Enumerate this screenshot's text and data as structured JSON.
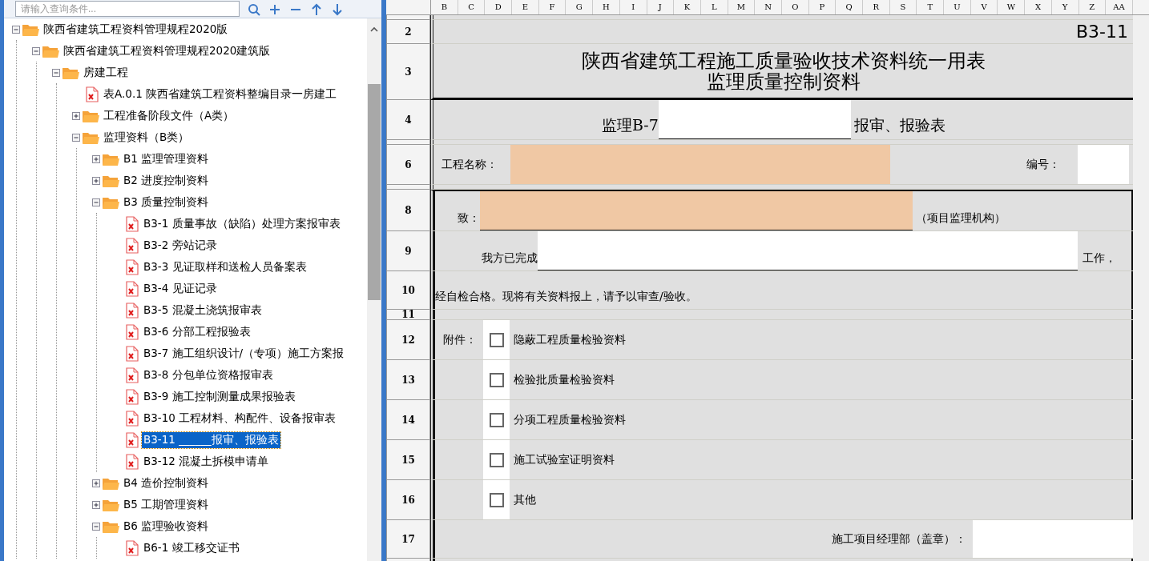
{
  "search": {
    "placeholder": "请输入查询条件..."
  },
  "tree": [
    {
      "label": "陕西省建筑工程资料管理规程2020版",
      "kind": "folder",
      "expanded": true,
      "selected": false,
      "children": [
        {
          "label": "陕西省建筑工程资料管理规程2020建筑版",
          "kind": "folder",
          "expanded": true,
          "selected": false,
          "children": [
            {
              "label": "房建工程",
              "kind": "folder",
              "expanded": true,
              "selected": false,
              "children": [
                {
                  "label": "表A.0.1 陕西省建筑工程资料整编目录一房建工",
                  "kind": "file",
                  "selected": false
                },
                {
                  "label": "工程准备阶段文件（A类）",
                  "kind": "folder",
                  "expanded": false,
                  "selected": false
                },
                {
                  "label": "监理资料（B类）",
                  "kind": "folder",
                  "expanded": true,
                  "selected": false,
                  "children": [
                    {
                      "label": "B1 监理管理资料",
                      "kind": "folder",
                      "expanded": false,
                      "selected": false
                    },
                    {
                      "label": "B2 进度控制资料",
                      "kind": "folder",
                      "expanded": false,
                      "selected": false
                    },
                    {
                      "label": "B3 质量控制资料",
                      "kind": "folder",
                      "expanded": true,
                      "selected": false,
                      "children": [
                        {
                          "label": "B3-1 质量事故（缺陷）处理方案报审表",
                          "kind": "file",
                          "selected": false
                        },
                        {
                          "label": "B3-2 旁站记录",
                          "kind": "file",
                          "selected": false
                        },
                        {
                          "label": "B3-3 见证取样和送检人员备案表",
                          "kind": "file",
                          "selected": false
                        },
                        {
                          "label": "B3-4 见证记录",
                          "kind": "file",
                          "selected": false
                        },
                        {
                          "label": "B3-5 混凝土浇筑报审表",
                          "kind": "file",
                          "selected": false
                        },
                        {
                          "label": "B3-6 分部工程报验表",
                          "kind": "file",
                          "selected": false
                        },
                        {
                          "label": "B3-7 施工组织设计/（专项）施工方案报",
                          "kind": "file",
                          "selected": false
                        },
                        {
                          "label": "B3-8 分包单位资格报审表",
                          "kind": "file",
                          "selected": false
                        },
                        {
                          "label": "B3-9 施工控制测量成果报验表",
                          "kind": "file",
                          "selected": false
                        },
                        {
                          "label": "B3-10 工程材料、构配件、设备报审表",
                          "kind": "file",
                          "selected": false
                        },
                        {
                          "label": "B3-11 ______报审、报验表",
                          "kind": "file",
                          "selected": true
                        },
                        {
                          "label": "B3-12 混凝土拆模申请单",
                          "kind": "file",
                          "selected": false
                        }
                      ]
                    },
                    {
                      "label": "B4 造价控制资料",
                      "kind": "folder",
                      "expanded": false,
                      "selected": false
                    },
                    {
                      "label": "B5 工期管理资料",
                      "kind": "folder",
                      "expanded": false,
                      "selected": false
                    },
                    {
                      "label": "B6 监理验收资料",
                      "kind": "folder",
                      "expanded": true,
                      "selected": false,
                      "children": [
                        {
                          "label": "B6-1 竣工移交证书",
                          "kind": "file",
                          "selected": false
                        }
                      ]
                    }
                  ]
                }
              ]
            }
          ]
        }
      ]
    }
  ],
  "sheet": {
    "columns": [
      "B",
      "C",
      "D",
      "E",
      "F",
      "G",
      "H",
      "I",
      "J",
      "K",
      "L",
      "M",
      "N",
      "O",
      "P",
      "Q",
      "R",
      "S",
      "T",
      "U",
      "V",
      "W",
      "X",
      "Y",
      "Z",
      "AA"
    ],
    "rows": [
      {
        "kind": "gap"
      },
      {
        "kind": "code",
        "number": "2",
        "text": "B3-11"
      },
      {
        "kind": "title",
        "number": "3",
        "lines": [
          "陕西省建筑工程施工质量验收技术资料统一用表",
          "监理质量控制资料"
        ]
      },
      {
        "kind": "form_name",
        "number": "4",
        "prefix": "监理B-7",
        "suffix": "报审、报验表"
      },
      {
        "kind": "gap"
      },
      {
        "kind": "project",
        "number": "6",
        "label": "工程名称：",
        "number_label": "编号："
      },
      {
        "kind": "gap"
      },
      {
        "kind": "to",
        "number": "8",
        "label": "致：",
        "suffix": "（项目监理机构）"
      },
      {
        "kind": "done",
        "number": "9",
        "label": "我方已完成",
        "suffix": "工作，"
      },
      {
        "kind": "statement",
        "number": "10",
        "text": "经自检合格。现将有关资料报上，请予以审查/验收。"
      },
      {
        "kind": "thin",
        "number": "11"
      },
      {
        "kind": "attachment",
        "number": "12",
        "label": "附件：",
        "text": "隐蔽工程质量检验资料",
        "checked": false
      },
      {
        "kind": "attachment",
        "number": "13",
        "text": "检验批质量检验资料",
        "checked": false
      },
      {
        "kind": "attachment",
        "number": "14",
        "text": "分项工程质量检验资料",
        "checked": false
      },
      {
        "kind": "attachment",
        "number": "15",
        "text": "施工试验室证明资料",
        "checked": false
      },
      {
        "kind": "attachment",
        "number": "16",
        "text": "其他",
        "checked": false
      },
      {
        "kind": "signature",
        "number": "17",
        "stamp_label": "施工项目经理部（盖章）："
      },
      {
        "kind": "tail"
      }
    ]
  }
}
